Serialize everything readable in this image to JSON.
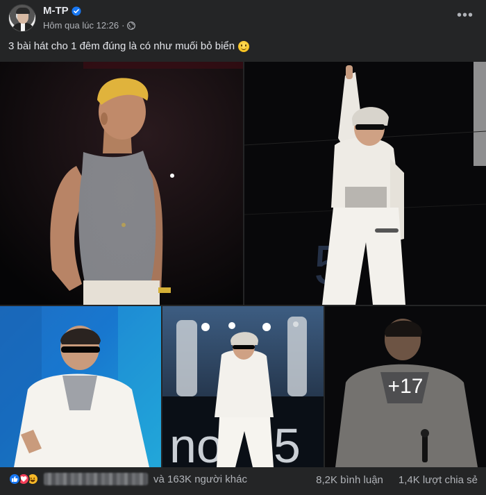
{
  "post": {
    "author": "M-TP",
    "timestamp": "Hôm qua lúc 12:26",
    "privacy_icon": "globe-icon",
    "caption": "3 bài hát cho 1 đêm đúng là có như muối bỏ biển",
    "caption_emoji": "slightly-smiling-face"
  },
  "photos": {
    "more_count": "+17"
  },
  "footer": {
    "reactions": [
      "like",
      "love",
      "haha"
    ],
    "others_text": "và 163K người khác",
    "comments": "8,2K bình luận",
    "shares": "1,4K lượt chia sẻ"
  },
  "colors": {
    "background": "#242526",
    "text_primary": "#e4e6eb",
    "text_secondary": "#b0b3b8",
    "verified_blue": "#1877f2"
  }
}
